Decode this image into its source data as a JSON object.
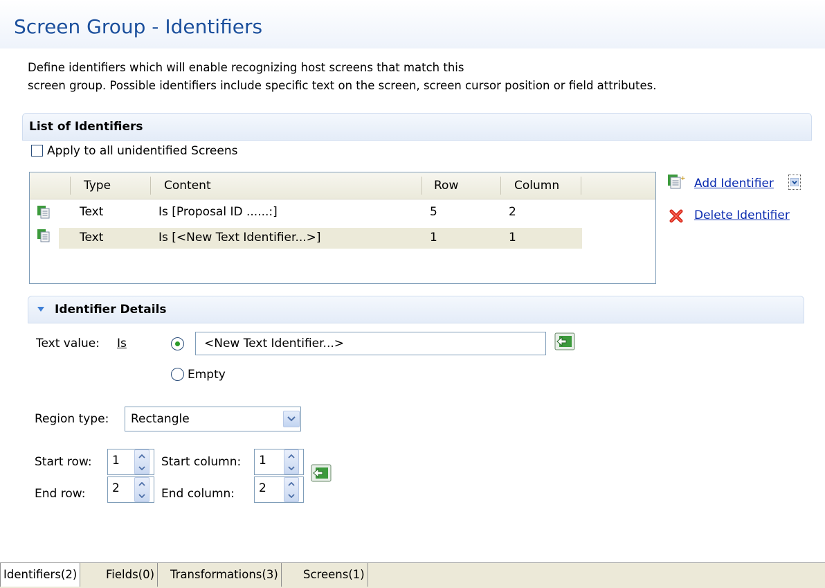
{
  "header": {
    "title": "Screen Group - Identifiers",
    "description_line1": "Define identifiers which will enable recognizing host screens that match this",
    "description_line2": "screen group. Possible identifiers include specific text on the screen, screen cursor position or field attributes."
  },
  "list_section": {
    "title": "List of Identifiers",
    "apply_all_label": "Apply to all unidentified Screens",
    "apply_all_checked": false,
    "columns": [
      "Type",
      "Content",
      "Row",
      "Column"
    ],
    "rows": [
      {
        "type": "Text",
        "content": "Is [Proposal ID ......:]",
        "row": "5",
        "column": "2"
      },
      {
        "type": "Text",
        "content": "Is [<New Text Identifier...>]",
        "row": "1",
        "column": "1"
      }
    ],
    "selected_row": 1,
    "add_label": "Add Identifier",
    "delete_label": "Delete Identifier"
  },
  "details_section": {
    "title": "Identifier Details",
    "text_value_label": "Text value:",
    "operator": "Is",
    "text_value": "<New Text Identifier...>",
    "empty_label": "Empty",
    "region_type_label": "Region type:",
    "region_type_value": "Rectangle",
    "start_row_label": "Start row:",
    "start_row_value": "1",
    "start_column_label": "Start column:",
    "start_column_value": "1",
    "end_row_label": "End row:",
    "end_row_value": "2",
    "end_column_label": "End column:",
    "end_column_value": "2"
  },
  "tabs": [
    {
      "label": "Identifiers(2)",
      "active": true
    },
    {
      "label": "Fields(0)",
      "active": false
    },
    {
      "label": "Transformations(3)",
      "active": false
    },
    {
      "label": "Screens(1)",
      "active": false
    }
  ],
  "colors": {
    "title": "#1b4f9c",
    "link": "#0a2bb0",
    "selected_row": "#ecead9",
    "accent_green": "#2a9a2a"
  }
}
